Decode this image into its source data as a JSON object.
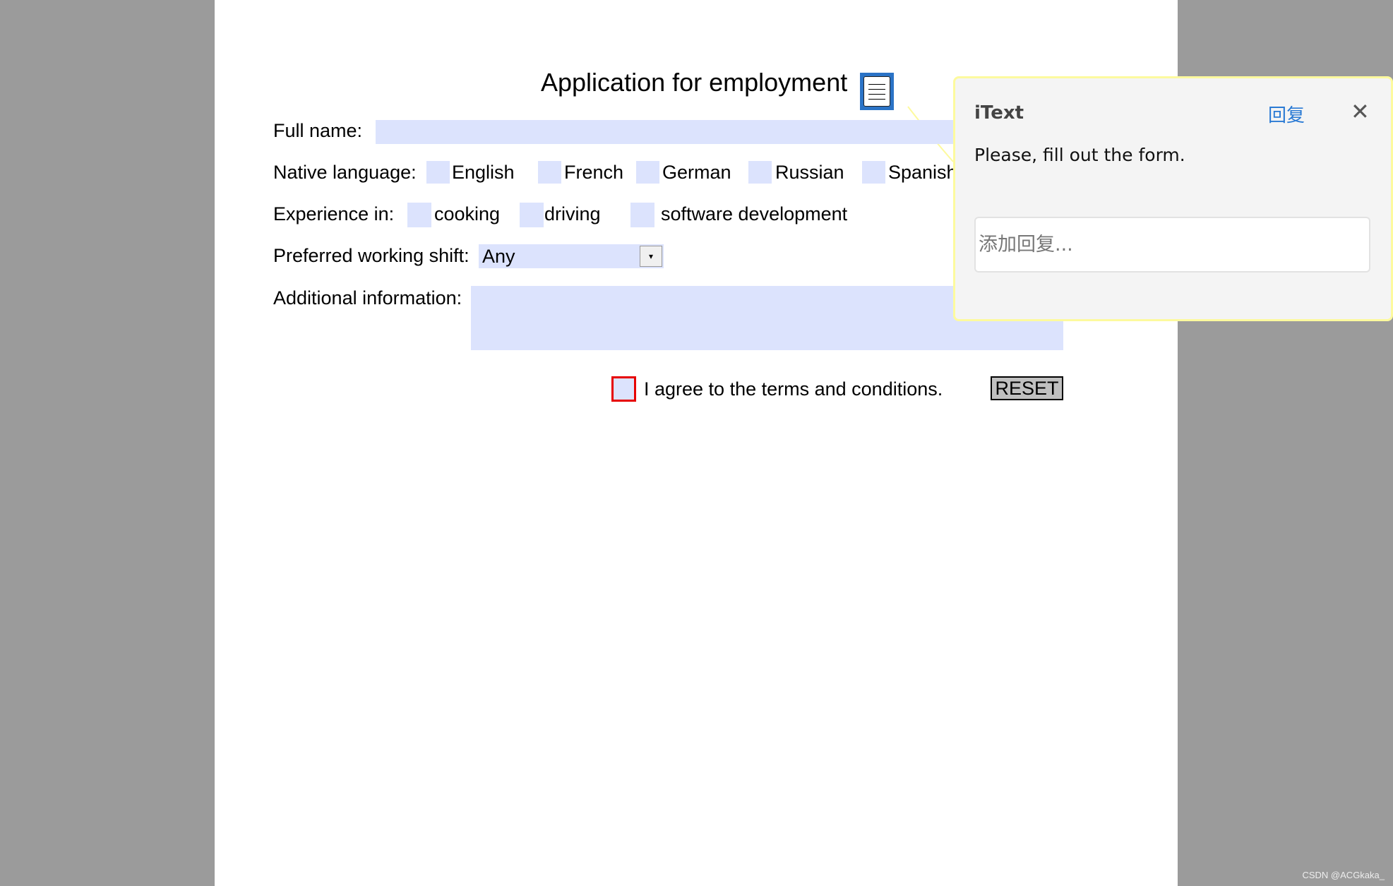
{
  "form": {
    "title": "Application for employment",
    "note_icon": "comment-note-icon",
    "full_name_label": "Full name:",
    "full_name_value": "",
    "native_language_label": "Native language:",
    "languages": [
      "English",
      "French",
      "German",
      "Russian",
      "Spanish"
    ],
    "experience_label": "Experience in:",
    "experience": [
      "cooking",
      "driving",
      "software development"
    ],
    "shift_label": "Preferred working shift:",
    "shift_value": "Any",
    "additional_label": "Additional information:",
    "additional_value": "",
    "agree_label": "I agree to the terms and conditions.",
    "reset_label": "RESET"
  },
  "popup": {
    "title": "iText",
    "reply_label": "回复",
    "close_icon": "close-icon",
    "message": "Please, fill out the form.",
    "reply_placeholder": "添加回复..."
  },
  "watermark": "CSDN @ACGkaka_",
  "colors": {
    "field": "#dce3fd",
    "required_border": "#e60000",
    "accent": "#2a7ad4",
    "popup_border": "#fdfa9e"
  }
}
